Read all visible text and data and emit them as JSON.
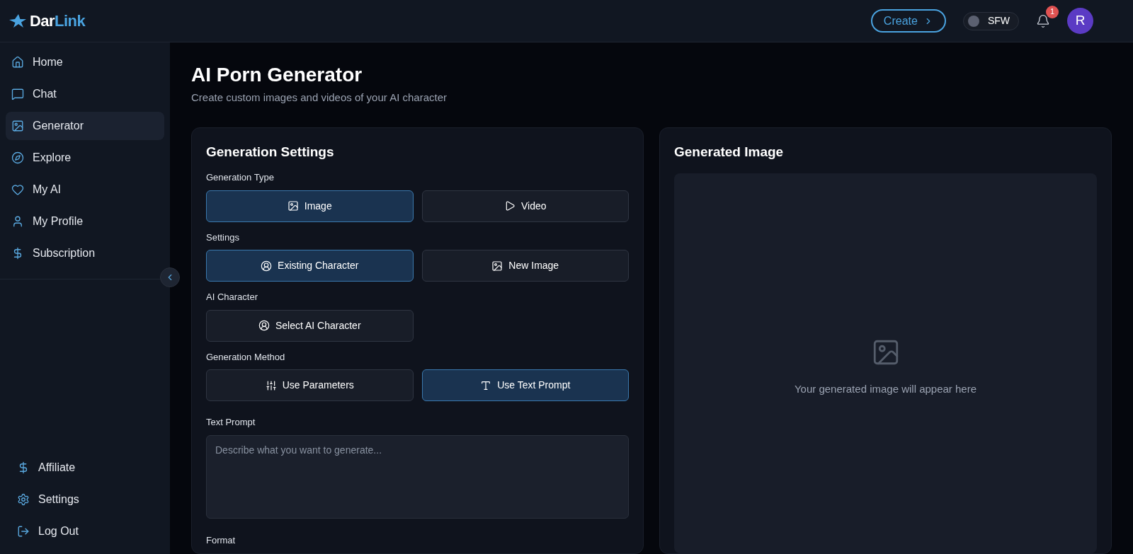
{
  "brand": {
    "part_1": "Dar",
    "part_2": "Link"
  },
  "header": {
    "create_button": "Create",
    "sfw_toggle": {
      "label": "SFW",
      "on": false
    },
    "notifications": {
      "count": "1"
    },
    "avatar": {
      "initial": "R"
    }
  },
  "sidebar": {
    "items": [
      {
        "label": "Home",
        "kind": "home",
        "selected": false
      },
      {
        "label": "Chat",
        "kind": "chat",
        "selected": false
      },
      {
        "label": "Generator",
        "kind": "image",
        "selected": true
      },
      {
        "label": "Explore",
        "kind": "compass",
        "selected": false
      },
      {
        "label": "My AI",
        "kind": "heart",
        "selected": false
      },
      {
        "label": "My Profile",
        "kind": "user",
        "selected": false
      },
      {
        "label": "Subscription",
        "kind": "dollar",
        "selected": false
      }
    ],
    "bottom_items": [
      {
        "label": "Affiliate",
        "kind": "dollar"
      },
      {
        "label": "Settings",
        "kind": "settings"
      },
      {
        "label": "Log Out",
        "kind": "logout"
      }
    ]
  },
  "page": {
    "title": "AI Porn Generator",
    "subtitle": "Create custom images and videos of your AI character"
  },
  "settings_card": {
    "title": "Generation Settings",
    "groups": [
      {
        "label": "Generation Type",
        "options": [
          {
            "label": "Image",
            "kind": "image",
            "selected": true
          },
          {
            "label": "Video",
            "kind": "play",
            "selected": false
          }
        ]
      },
      {
        "label": "Settings",
        "options": [
          {
            "label": "Existing Character",
            "kind": "user-circle",
            "selected": true
          },
          {
            "label": "New Image",
            "kind": "image",
            "selected": false
          }
        ]
      },
      {
        "label": "AI Character",
        "options": [
          {
            "label": "Select AI Character",
            "kind": "user-circle",
            "selected": false
          }
        ]
      },
      {
        "label": "Generation Method",
        "options": [
          {
            "label": "Use Parameters",
            "kind": "sliders",
            "selected": false
          },
          {
            "label": "Use Text Prompt",
            "kind": "type",
            "selected": true
          }
        ]
      }
    ],
    "text_prompt": {
      "label": "Text Prompt",
      "placeholder": "Describe what you want to generate..."
    },
    "format_label": "Format"
  },
  "preview": {
    "title": "Generated Image",
    "placeholder": "Your generated image will appear here"
  }
}
